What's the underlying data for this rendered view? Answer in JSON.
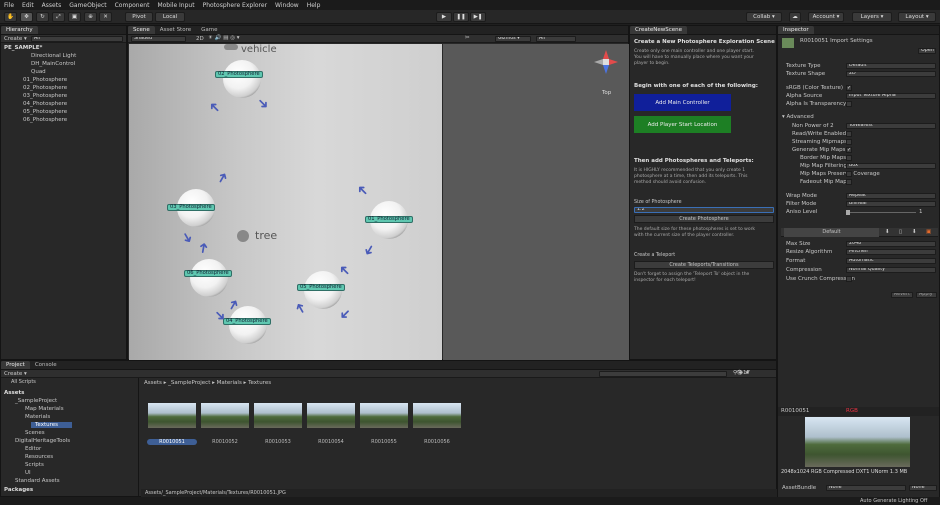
{
  "menubar": {
    "items": [
      "File",
      "Edit",
      "Assets",
      "GameObject",
      "Component",
      "Mobile Input",
      "Photosphere Explorer",
      "Window",
      "Help"
    ]
  },
  "toolbar": {
    "pivot": "Pivot",
    "local": "Local",
    "collab": "Collab ▾",
    "account": "Account ▾",
    "layers": "Layers ▾",
    "layout": "Layout ▾"
  },
  "hierarchy": {
    "tab": "Hierarchy",
    "create": "Create ▾",
    "search_placeholder": "All",
    "scene": "PE_SAMPLE*",
    "items": [
      "Directional Light",
      "DH_MainControl",
      "Quad",
      "01_Photosphere",
      "02_Photosphere",
      "03_Photosphere",
      "04_Photosphere",
      "05_Photosphere",
      "06_Photosphere"
    ]
  },
  "scene": {
    "tab_scene": "Scene",
    "tab_store": "Asset Store",
    "tab_game": "Game",
    "shading": "Shaded",
    "mode2d": "2D",
    "gizmos": "Gizmos ▾",
    "search_placeholder": "All",
    "gizmo_label": "Top",
    "vehicle": "vehicle",
    "tree": "tree",
    "nodes": [
      "02_Photosphere",
      "03_Photosphere",
      "01_Photosphere",
      "06_Photosphere",
      "05_Photosphere",
      "04_Photosphere"
    ]
  },
  "create_scene": {
    "tab": "CreateNewScene",
    "title": "Create a New Photosphere Exploration Scene",
    "intro": [
      "Create only one main controller and one player start.",
      "You will have to manually place where you want your",
      "player to begin."
    ],
    "begin_heading": "Begin with one of each of the following:",
    "add_main": "Add Main Controller",
    "add_player": "Add Player Start Location",
    "then_heading": "Then add Photospheres and Teleports:",
    "then_text": [
      "It is HIGHLY recommended that you only create 1",
      "photosphere at a time, then add its teleports. This",
      "method should avoid confusion."
    ],
    "size_label": "Size of Photosphere",
    "size_value": "1.2",
    "create_photosphere": "Create Photosphere",
    "size_note": [
      "The default size for these photospheres is set to work",
      "with the current size of the player controller."
    ],
    "teleport_label": "Create a Teleport",
    "create_teleports": "Create Teleports/Transitions",
    "teleport_note": [
      "Don't forget to assign the 'Teleport To' object in the",
      "inspector for each teleport!"
    ]
  },
  "inspector": {
    "tab": "Inspector",
    "asset_title": "R0010051 Import Settings",
    "open": "Open",
    "texture_type": "Texture Type",
    "texture_type_val": "Default",
    "texture_shape": "Texture Shape",
    "texture_shape_val": "2D",
    "srgb": "sRGB (Color Texture)",
    "alpha_source": "Alpha Source",
    "alpha_source_val": "Input Texture Alpha",
    "alpha_transp": "Alpha Is Transparency",
    "advanced": "Advanced",
    "non_power": "Non Power of 2",
    "non_power_val": "ToNearest",
    "read_write": "Read/Write Enabled",
    "streaming": "Streaming Mipmaps",
    "gen_mip": "Generate Mip Maps",
    "border_mip": "Border Mip Maps",
    "mip_filter": "Mip Map Filtering",
    "mip_filter_val": "Box",
    "mip_preserve": "Mip Maps Preserve Coverage",
    "fadeout": "Fadeout Mip Maps",
    "wrap": "Wrap Mode",
    "wrap_val": "Repeat",
    "filter": "Filter Mode",
    "filter_val": "Bilinear",
    "aniso": "Aniso Level",
    "aniso_val": "1",
    "platform_default": "Default",
    "max_size": "Max Size",
    "max_size_val": "2048",
    "resize": "Resize Algorithm",
    "resize_val": "Mitchell",
    "format": "Format",
    "format_val": "Automatic",
    "compression": "Compression",
    "compression_val": "Normal Quality",
    "crunch": "Use Crunch Compression",
    "revert": "Revert",
    "apply": "Apply",
    "preview_name": "R0010051",
    "preview_rgb": "RGB",
    "preview_info": "2048x1024  RGB Compressed DXT1 UNorm  1.3 MB",
    "asset_bundle": "AssetBundle",
    "bundle_val": "None",
    "bundle_variant": "None"
  },
  "project": {
    "tab_project": "Project",
    "tab_console": "Console",
    "create": "Create ▾",
    "all_scripts": "All Scripts",
    "tree": [
      "Assets",
      "_SampleProject",
      "Map Materials",
      "Materials",
      "Textures",
      "Scenes",
      "DigitalHeritageTools",
      "Editor",
      "Resources",
      "Scripts",
      "UI",
      "Standard Assets",
      "Packages"
    ],
    "breadcrumb": "Assets ▸ _SampleProject ▸ Materials ▸ Textures",
    "thumbs": [
      "R0010051",
      "R0010052",
      "R0010053",
      "R0010054",
      "R0010055",
      "R0010056"
    ],
    "footer_path": "Assets/_SampleProject/Materials/Textures/R0010051.JPG",
    "count": "17"
  },
  "status": {
    "text": "Auto Generate Lighting Off"
  }
}
